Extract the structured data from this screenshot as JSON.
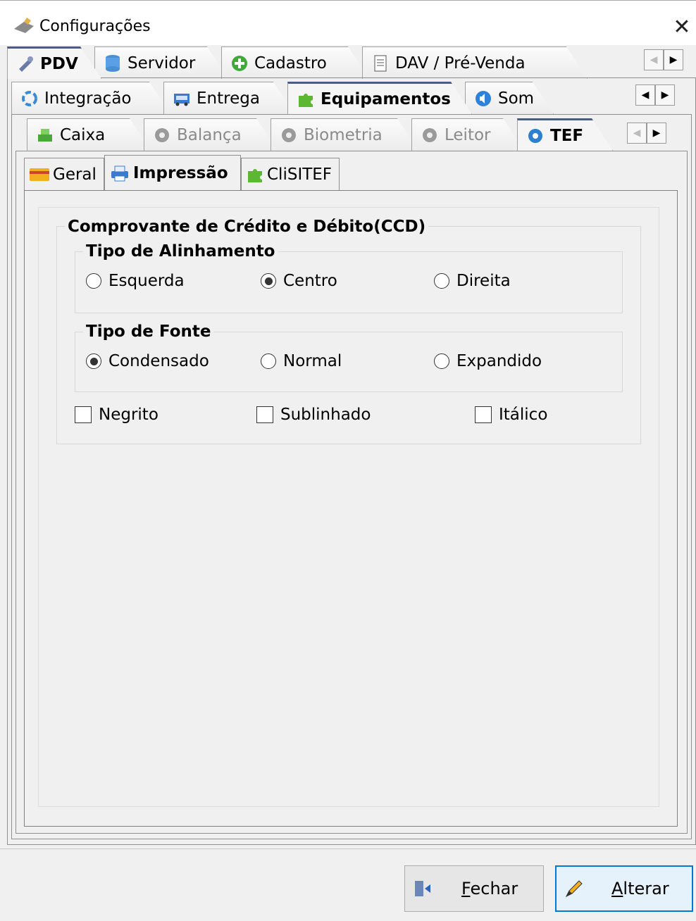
{
  "window": {
    "title": "Configurações"
  },
  "tabs_row1": [
    {
      "label": "PDV",
      "icon": "tools-icon",
      "active": true
    },
    {
      "label": "Servidor",
      "icon": "database-icon"
    },
    {
      "label": "Cadastro",
      "icon": "add-circle-icon"
    },
    {
      "label": "DAV / Pré-Venda",
      "icon": "document-icon"
    }
  ],
  "tabs_row2": [
    {
      "label": "Integração",
      "icon": "integration-icon"
    },
    {
      "label": "Entrega",
      "icon": "truck-icon"
    },
    {
      "label": "Equipamentos",
      "icon": "puzzle-icon",
      "active": true
    },
    {
      "label": "Som",
      "icon": "speaker-icon"
    }
  ],
  "tabs_row3": [
    {
      "label": "Caixa",
      "icon": "cash-register-icon"
    },
    {
      "label": "Balança",
      "icon": "gear-icon",
      "disabled": true
    },
    {
      "label": "Biometria",
      "icon": "gear-icon",
      "disabled": true
    },
    {
      "label": "Leitor",
      "icon": "gear-icon",
      "disabled": true
    },
    {
      "label": "TEF",
      "icon": "gear-icon",
      "active": true
    }
  ],
  "tabs_row4": [
    {
      "label": "Geral",
      "icon": "card-icon"
    },
    {
      "label": "Impressão",
      "icon": "printer-icon",
      "active": true
    },
    {
      "label": "CliSITEF",
      "icon": "puzzle-icon"
    }
  ],
  "ccd": {
    "title": "Comprovante de Crédito e Débito(CCD)",
    "alignment": {
      "title": "Tipo de Alinhamento",
      "options": [
        "Esquerda",
        "Centro",
        "Direita"
      ],
      "selected": "Centro"
    },
    "font": {
      "title": "Tipo de Fonte",
      "options": [
        "Condensado",
        "Normal",
        "Expandido"
      ],
      "selected": "Condensado"
    },
    "styles": {
      "bold": {
        "label": "Negrito",
        "checked": false
      },
      "underline": {
        "label": "Sublinhado",
        "checked": false
      },
      "italic": {
        "label": "Itálico",
        "checked": false
      }
    }
  },
  "buttons": {
    "close": {
      "prefix": "",
      "underlined": "F",
      "rest": "echar"
    },
    "edit": {
      "prefix": "",
      "underlined": "A",
      "rest": "lterar"
    }
  },
  "colors": {
    "active_tab_accent": "#4b5c7d",
    "focus_border": "#0078d7"
  }
}
